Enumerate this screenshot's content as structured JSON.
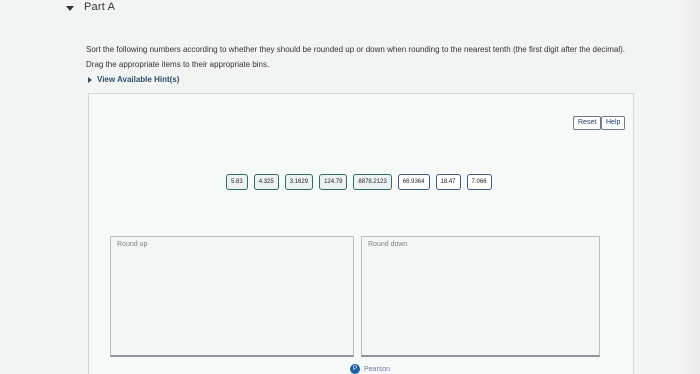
{
  "part": {
    "title": "Part A"
  },
  "instructions": {
    "line1": "Sort the following numbers according to whether they should be rounded up or down when rounding to the nearest tenth (the first digit after the decimal).",
    "line2": "Drag the appropriate items to their appropriate bins."
  },
  "hints": {
    "label": "View Available Hint(s)"
  },
  "toolbar": {
    "reset_label": "Reset",
    "help_label": "Help"
  },
  "items": [
    "5.83",
    "4.325",
    "3.1629",
    "124.79",
    "8878.2123",
    "66.9364",
    "18.47",
    "7.066"
  ],
  "bins": {
    "round_up": {
      "label": "Round up"
    },
    "round_down": {
      "label": "Round down"
    }
  },
  "footer": {
    "brand": "Pearson"
  }
}
